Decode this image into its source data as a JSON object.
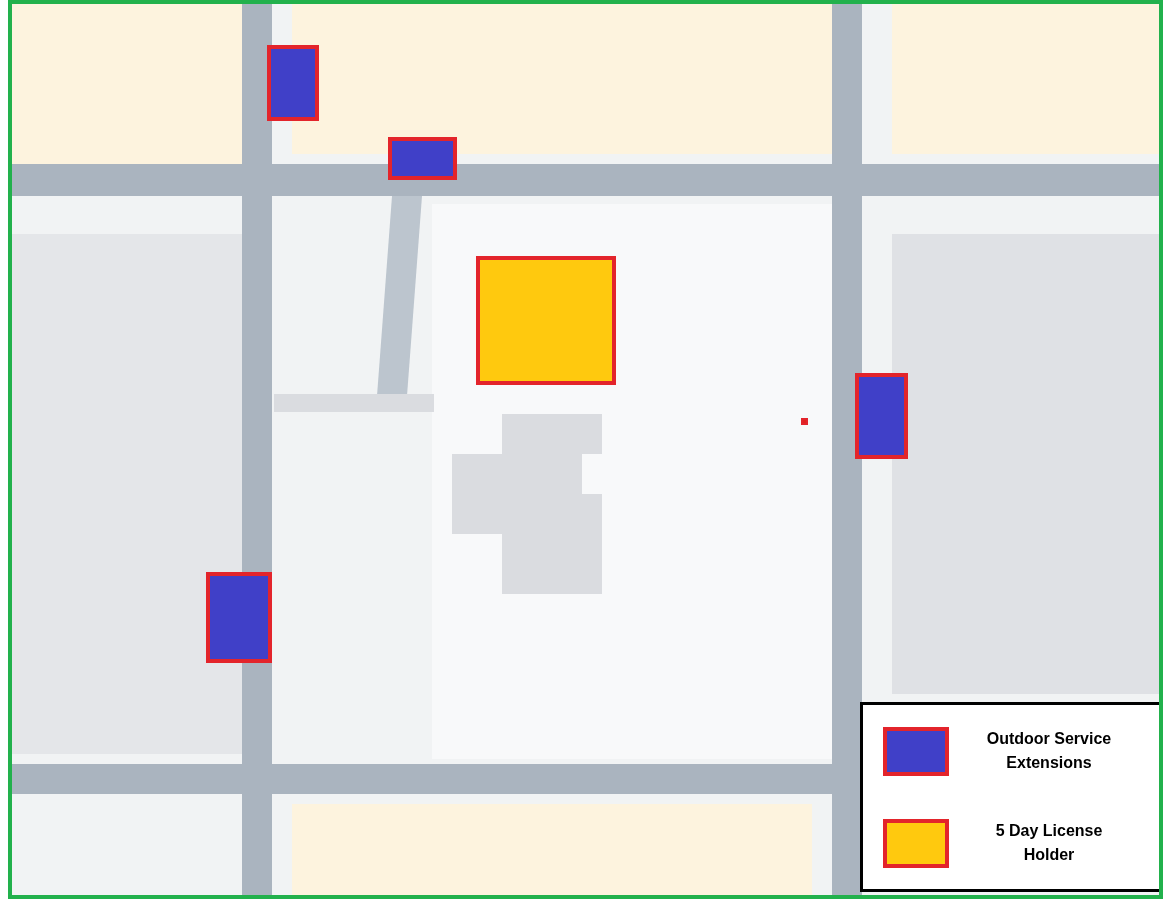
{
  "markers": [
    {
      "color": "#4040c8"
    },
    {
      "color": "#4040c8"
    },
    {
      "color": "#ffc90e"
    },
    {
      "color": "#4040c8"
    },
    {
      "color": "#4040c8"
    },
    {
      "color": "#e02020"
    }
  ],
  "legend": {
    "items": [
      {
        "label": "Outdoor Service Extensions",
        "color": "#4040c8"
      },
      {
        "label": "5 Day License Holder",
        "color": "#ffc90e"
      }
    ]
  }
}
